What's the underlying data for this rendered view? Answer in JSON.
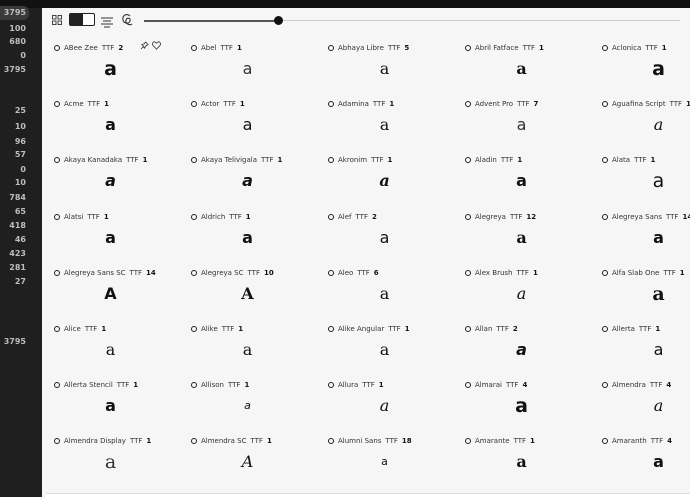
{
  "sidebar": {
    "counts": [
      "3795",
      "100",
      "680",
      "0",
      "3795",
      "25",
      "10",
      "96",
      "57",
      "0",
      "10",
      "784",
      "65",
      "418",
      "46",
      "423",
      "281",
      "27",
      "3795"
    ]
  },
  "toolbar": {
    "grid_icon": "grid-icon",
    "toggle_icon": "theme-toggle-icon",
    "align_icon": "align-center-icon",
    "swash_icon": "swash-glyph-icon",
    "slider_value": 0.25
  },
  "fonts": [
    {
      "name": "ABee Zee",
      "format": "TTF",
      "count": "2",
      "sample": "a",
      "style": "s-bold s-big"
    },
    {
      "name": "Abel",
      "format": "TTF",
      "count": "1",
      "sample": "a",
      "style": "s-light"
    },
    {
      "name": "Abhaya Libre",
      "format": "TTF",
      "count": "5",
      "sample": "a",
      "style": "s-serif"
    },
    {
      "name": "Abril Fatface",
      "format": "TTF",
      "count": "1",
      "sample": "a",
      "style": "s-serif s-bold"
    },
    {
      "name": "Aclonica",
      "format": "TTF",
      "count": "1",
      "sample": "a",
      "style": "s-bold s-big"
    },
    {
      "name": "Acme",
      "format": "TTF",
      "count": "1",
      "sample": "a",
      "style": "s-bold"
    },
    {
      "name": "Actor",
      "format": "TTF",
      "count": "1",
      "sample": "a",
      "style": ""
    },
    {
      "name": "Adamina",
      "format": "TTF",
      "count": "1",
      "sample": "a",
      "style": "s-serif"
    },
    {
      "name": "Advent Pro",
      "format": "TTF",
      "count": "7",
      "sample": "a",
      "style": "s-light"
    },
    {
      "name": "Aguafina Script",
      "format": "TTF",
      "count": "1",
      "sample": "a",
      "style": "s-ital s-serif"
    },
    {
      "name": "Akaya Kanadaka",
      "format": "TTF",
      "count": "1",
      "sample": "a",
      "style": "s-bold s-ital"
    },
    {
      "name": "Akaya Telivigala",
      "format": "TTF",
      "count": "1",
      "sample": "a",
      "style": "s-bold s-ital"
    },
    {
      "name": "Akronim",
      "format": "TTF",
      "count": "1",
      "sample": "a",
      "style": "s-bold s-ital s-serif"
    },
    {
      "name": "Aladin",
      "format": "TTF",
      "count": "1",
      "sample": "a",
      "style": "s-bold"
    },
    {
      "name": "Alata",
      "format": "TTF",
      "count": "1",
      "sample": "a",
      "style": "s-big"
    },
    {
      "name": "Alatsi",
      "format": "TTF",
      "count": "1",
      "sample": "a",
      "style": "s-bold"
    },
    {
      "name": "Aldrich",
      "format": "TTF",
      "count": "1",
      "sample": "a",
      "style": "s-bold"
    },
    {
      "name": "Alef",
      "format": "TTF",
      "count": "2",
      "sample": "a",
      "style": ""
    },
    {
      "name": "Alegreya",
      "format": "TTF",
      "count": "12",
      "sample": "a",
      "style": "s-serif s-bold"
    },
    {
      "name": "Alegreya Sans",
      "format": "TTF",
      "count": "14",
      "sample": "a",
      "style": "s-bold"
    },
    {
      "name": "Alegreya Sans SC",
      "format": "TTF",
      "count": "14",
      "sample": "A",
      "style": "s-bold"
    },
    {
      "name": "Alegreya SC",
      "format": "TTF",
      "count": "10",
      "sample": "A",
      "style": "s-serif s-bold"
    },
    {
      "name": "Aleo",
      "format": "TTF",
      "count": "6",
      "sample": "a",
      "style": "s-serif"
    },
    {
      "name": "Alex Brush",
      "format": "TTF",
      "count": "1",
      "sample": "a",
      "style": "s-ital s-serif"
    },
    {
      "name": "Alfa Slab One",
      "format": "TTF",
      "count": "1",
      "sample": "a",
      "style": "s-serif s-bold s-big"
    },
    {
      "name": "Alice",
      "format": "TTF",
      "count": "1",
      "sample": "a",
      "style": "s-serif"
    },
    {
      "name": "Alike",
      "format": "TTF",
      "count": "1",
      "sample": "a",
      "style": "s-serif"
    },
    {
      "name": "Alike Angular",
      "format": "TTF",
      "count": "1",
      "sample": "a",
      "style": "s-serif"
    },
    {
      "name": "Allan",
      "format": "TTF",
      "count": "2",
      "sample": "a",
      "style": "s-bold s-ital"
    },
    {
      "name": "Allerta",
      "format": "TTF",
      "count": "1",
      "sample": "a",
      "style": ""
    },
    {
      "name": "Allerta Stencil",
      "format": "TTF",
      "count": "1",
      "sample": "a",
      "style": "s-bold"
    },
    {
      "name": "Allison",
      "format": "TTF",
      "count": "1",
      "sample": "a",
      "style": "s-ital s-small"
    },
    {
      "name": "Allura",
      "format": "TTF",
      "count": "1",
      "sample": "a",
      "style": "s-ital s-serif"
    },
    {
      "name": "Almarai",
      "format": "TTF",
      "count": "4",
      "sample": "a",
      "style": "s-bold s-big"
    },
    {
      "name": "Almendra",
      "format": "TTF",
      "count": "4",
      "sample": "a",
      "style": "s-serif s-ital"
    },
    {
      "name": "Almendra Display",
      "format": "TTF",
      "count": "1",
      "sample": "a",
      "style": "s-serif s-light s-big"
    },
    {
      "name": "Almendra SC",
      "format": "TTF",
      "count": "1",
      "sample": "A",
      "style": "s-serif s-ital"
    },
    {
      "name": "Alumni Sans",
      "format": "TTF",
      "count": "18",
      "sample": "a",
      "style": "s-small"
    },
    {
      "name": "Amarante",
      "format": "TTF",
      "count": "1",
      "sample": "a",
      "style": "s-serif s-bold"
    },
    {
      "name": "Amaranth",
      "format": "TTF",
      "count": "4",
      "sample": "a",
      "style": "s-bold"
    }
  ],
  "card_tools": {
    "pin_icon": "pin-icon",
    "heart_icon": "heart-icon"
  }
}
